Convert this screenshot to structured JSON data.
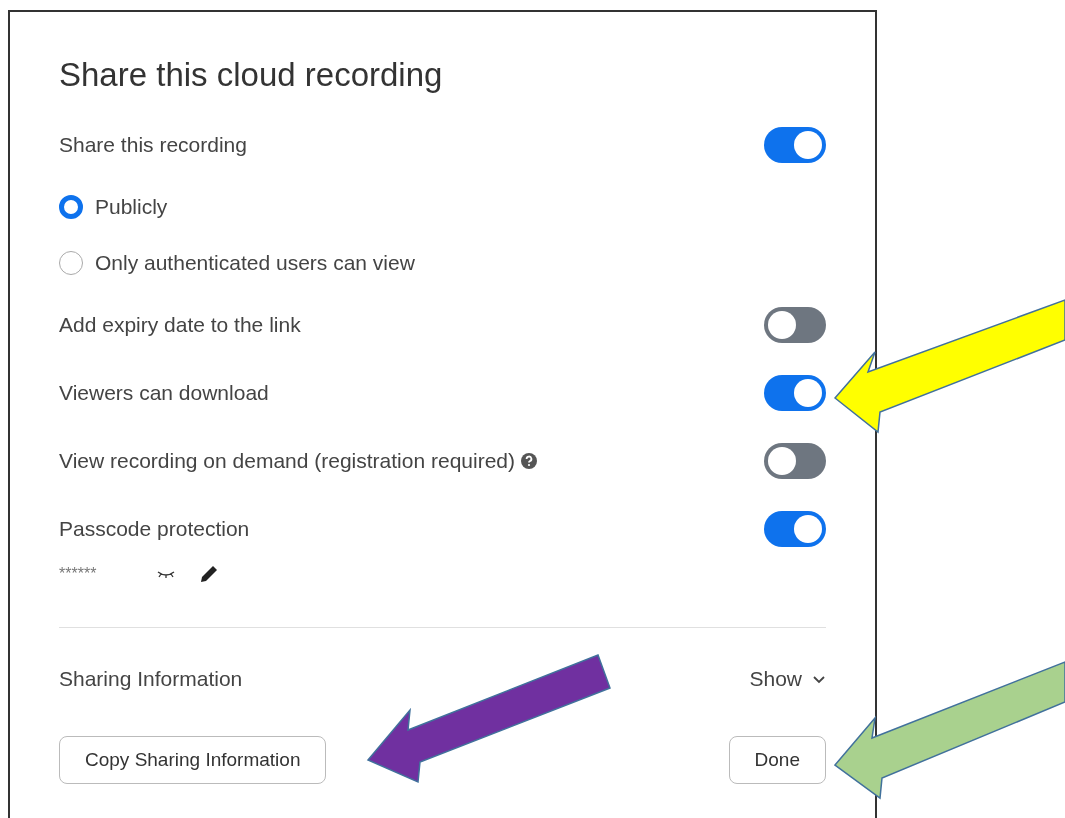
{
  "title": "Share this cloud recording",
  "rows": [
    {
      "kind": "toggle",
      "label": "Share this recording",
      "on": true
    },
    {
      "kind": "radio",
      "label": "Publicly",
      "selected": true
    },
    {
      "kind": "radio",
      "label": "Only authenticated users can view",
      "selected": false
    },
    {
      "kind": "toggle",
      "label": "Add expiry date to the link",
      "on": false
    },
    {
      "kind": "toggle",
      "label": "Viewers can download",
      "on": true
    },
    {
      "kind": "toggle",
      "label": "View recording on demand (registration required)",
      "on": false,
      "help_icon": true
    },
    {
      "kind": "toggle",
      "label": "Passcode protection",
      "on": true
    }
  ],
  "passcode": {
    "value": "******"
  },
  "sharing_information": {
    "label": "Sharing Information",
    "toggle": "Show"
  },
  "buttons": [
    {
      "label": "Copy Sharing Information"
    },
    {
      "label": "Done"
    }
  ],
  "annotations": [
    {
      "kind": "arrow",
      "color": "#ffff00"
    },
    {
      "kind": "arrow",
      "color": "#7030a0"
    },
    {
      "kind": "arrow",
      "color": "#a9d18e"
    }
  ]
}
